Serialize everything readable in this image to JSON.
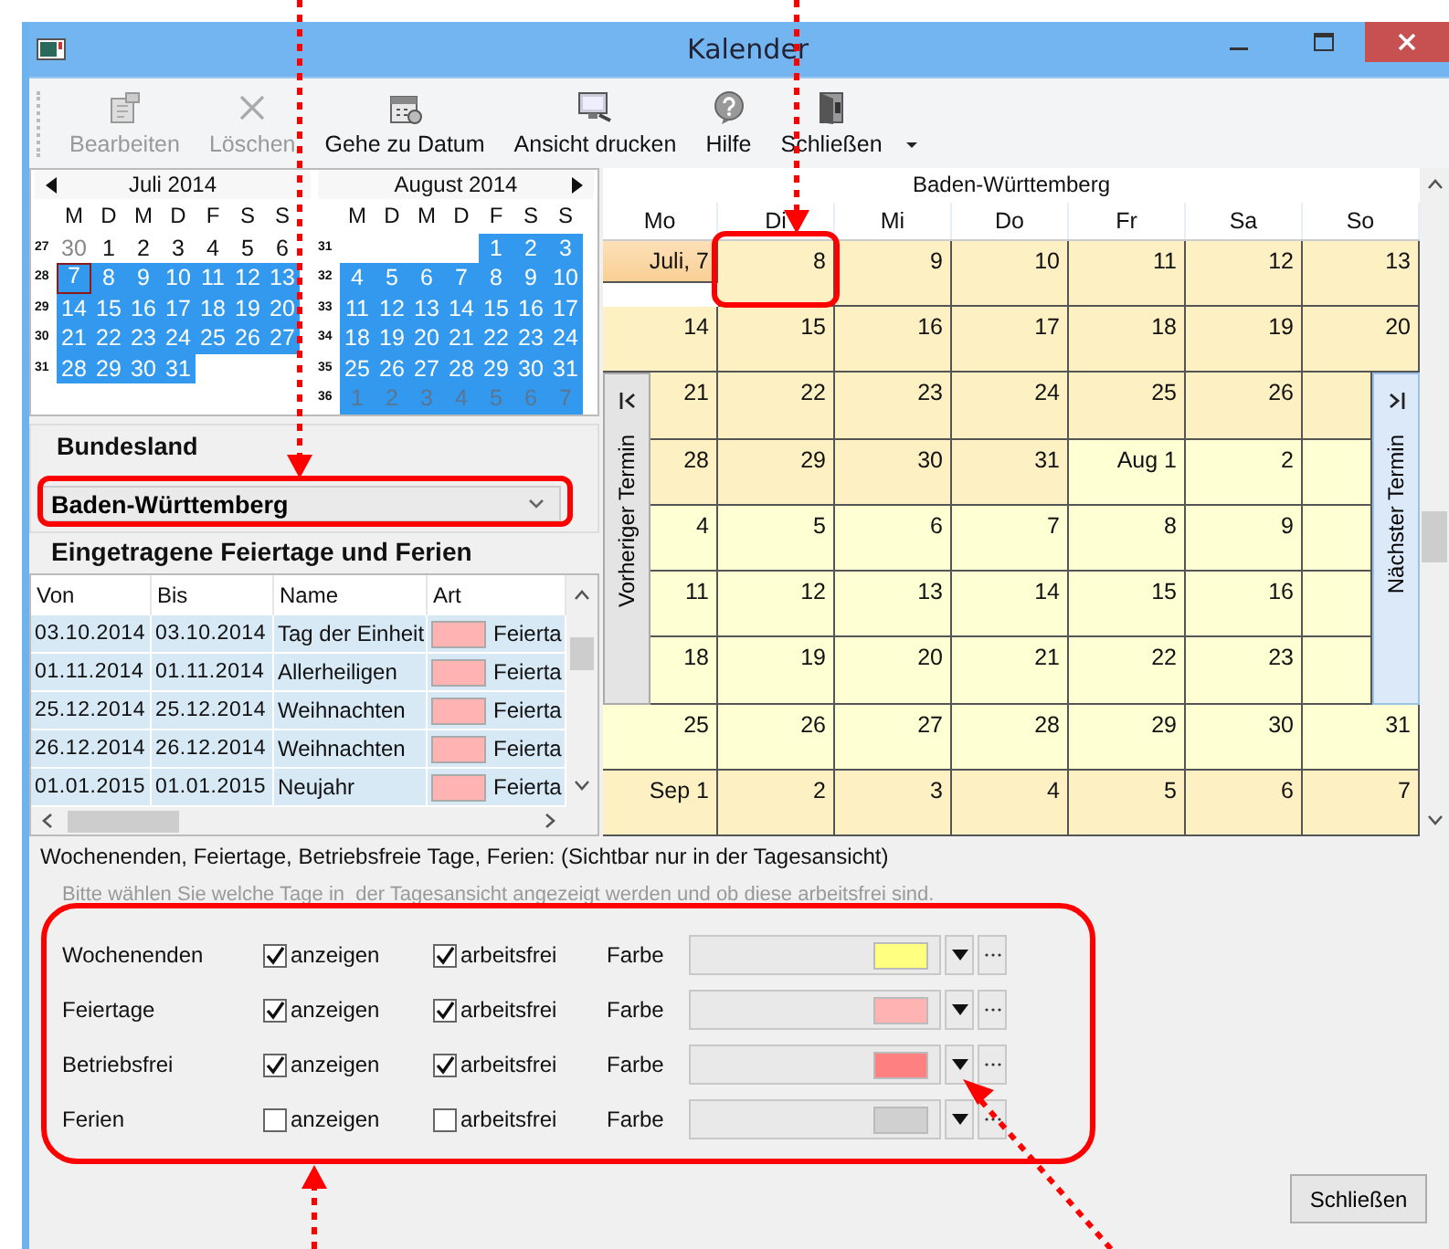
{
  "window": {
    "title": "Kalender"
  },
  "toolbar": [
    {
      "label": "Bearbeiten",
      "disabled": true
    },
    {
      "label": "Löschen",
      "disabled": true
    },
    {
      "label": "Gehe zu Datum",
      "disabled": false
    },
    {
      "label": "Ansicht drucken",
      "disabled": false
    },
    {
      "label": "Hilfe",
      "disabled": false
    },
    {
      "label": "Schließen",
      "disabled": false
    }
  ],
  "mini_calendars": [
    {
      "title": "Juli 2014",
      "weekdays": [
        "M",
        "D",
        "M",
        "D",
        "F",
        "S",
        "S"
      ],
      "weeks": [
        {
          "number": "27",
          "days": [
            {
              "label": "30",
              "selected": false,
              "muted": true,
              "today": false
            },
            {
              "label": "1",
              "selected": false,
              "muted": false,
              "today": false
            },
            {
              "label": "2",
              "selected": false,
              "muted": false,
              "today": false
            },
            {
              "label": "3",
              "selected": false,
              "muted": false,
              "today": false
            },
            {
              "label": "4",
              "selected": false,
              "muted": false,
              "today": false
            },
            {
              "label": "5",
              "selected": false,
              "muted": false,
              "today": false
            },
            {
              "label": "6",
              "selected": false,
              "muted": false,
              "today": false
            }
          ]
        },
        {
          "number": "28",
          "days": [
            {
              "label": "7",
              "selected": true,
              "muted": false,
              "today": true
            },
            {
              "label": "8",
              "selected": true,
              "muted": false,
              "today": false
            },
            {
              "label": "9",
              "selected": true,
              "muted": false,
              "today": false
            },
            {
              "label": "10",
              "selected": true,
              "muted": false,
              "today": false
            },
            {
              "label": "11",
              "selected": true,
              "muted": false,
              "today": false
            },
            {
              "label": "12",
              "selected": true,
              "muted": false,
              "today": false
            },
            {
              "label": "13",
              "selected": true,
              "muted": false,
              "today": false
            }
          ]
        },
        {
          "number": "29",
          "days": [
            {
              "label": "14",
              "selected": true,
              "muted": false,
              "today": false
            },
            {
              "label": "15",
              "selected": true,
              "muted": false,
              "today": false
            },
            {
              "label": "16",
              "selected": true,
              "muted": false,
              "today": false
            },
            {
              "label": "17",
              "selected": true,
              "muted": false,
              "today": false
            },
            {
              "label": "18",
              "selected": true,
              "muted": false,
              "today": false
            },
            {
              "label": "19",
              "selected": true,
              "muted": false,
              "today": false
            },
            {
              "label": "20",
              "selected": true,
              "muted": false,
              "today": false
            }
          ]
        },
        {
          "number": "30",
          "days": [
            {
              "label": "21",
              "selected": true,
              "muted": false,
              "today": false
            },
            {
              "label": "22",
              "selected": true,
              "muted": false,
              "today": false
            },
            {
              "label": "23",
              "selected": true,
              "muted": false,
              "today": false
            },
            {
              "label": "24",
              "selected": true,
              "muted": false,
              "today": false
            },
            {
              "label": "25",
              "selected": true,
              "muted": false,
              "today": false
            },
            {
              "label": "26",
              "selected": true,
              "muted": false,
              "today": false
            },
            {
              "label": "27",
              "selected": true,
              "muted": false,
              "today": false
            }
          ]
        },
        {
          "number": "31",
          "days": [
            {
              "label": "28",
              "selected": true,
              "muted": false,
              "today": false
            },
            {
              "label": "29",
              "selected": true,
              "muted": false,
              "today": false
            },
            {
              "label": "30",
              "selected": true,
              "muted": false,
              "today": false
            },
            {
              "label": "31",
              "selected": true,
              "muted": false,
              "today": false
            }
          ]
        }
      ]
    },
    {
      "title": "August 2014",
      "weekdays": [
        "M",
        "D",
        "M",
        "D",
        "F",
        "S",
        "S"
      ],
      "weeks": [
        {
          "number": "31",
          "days": [
            {
              "label": "1",
              "selected": true,
              "muted": false,
              "today": false
            },
            {
              "label": "2",
              "selected": true,
              "muted": false,
              "today": false
            },
            {
              "label": "3",
              "selected": true,
              "muted": false,
              "today": false
            }
          ]
        },
        {
          "number": "32",
          "days": [
            {
              "label": "4",
              "selected": true,
              "muted": false,
              "today": false
            },
            {
              "label": "5",
              "selected": true,
              "muted": false,
              "today": false
            },
            {
              "label": "6",
              "selected": true,
              "muted": false,
              "today": false
            },
            {
              "label": "7",
              "selected": true,
              "muted": false,
              "today": false
            },
            {
              "label": "8",
              "selected": true,
              "muted": false,
              "today": false
            },
            {
              "label": "9",
              "selected": true,
              "muted": false,
              "today": false
            },
            {
              "label": "10",
              "selected": true,
              "muted": false,
              "today": false
            }
          ]
        },
        {
          "number": "33",
          "days": [
            {
              "label": "11",
              "selected": true,
              "muted": false,
              "today": false
            },
            {
              "label": "12",
              "selected": true,
              "muted": false,
              "today": false
            },
            {
              "label": "13",
              "selected": true,
              "muted": false,
              "today": false
            },
            {
              "label": "14",
              "selected": true,
              "muted": false,
              "today": false
            },
            {
              "label": "15",
              "selected": true,
              "muted": false,
              "today": false
            },
            {
              "label": "16",
              "selected": true,
              "muted": false,
              "today": false
            },
            {
              "label": "17",
              "selected": true,
              "muted": false,
              "today": false
            }
          ]
        },
        {
          "number": "34",
          "days": [
            {
              "label": "18",
              "selected": true,
              "muted": false,
              "today": false
            },
            {
              "label": "19",
              "selected": true,
              "muted": false,
              "today": false
            },
            {
              "label": "20",
              "selected": true,
              "muted": false,
              "today": false
            },
            {
              "label": "21",
              "selected": true,
              "muted": false,
              "today": false
            },
            {
              "label": "22",
              "selected": true,
              "muted": false,
              "today": false
            },
            {
              "label": "23",
              "selected": true,
              "muted": false,
              "today": false
            },
            {
              "label": "24",
              "selected": true,
              "muted": false,
              "today": false
            }
          ]
        },
        {
          "number": "35",
          "days": [
            {
              "label": "25",
              "selected": true,
              "muted": false,
              "today": false
            },
            {
              "label": "26",
              "selected": true,
              "muted": false,
              "today": false
            },
            {
              "label": "27",
              "selected": true,
              "muted": false,
              "today": false
            },
            {
              "label": "28",
              "selected": true,
              "muted": false,
              "today": false
            },
            {
              "label": "29",
              "selected": true,
              "muted": false,
              "today": false
            },
            {
              "label": "30",
              "selected": true,
              "muted": false,
              "today": false
            },
            {
              "label": "31",
              "selected": true,
              "muted": false,
              "today": false
            }
          ]
        },
        {
          "number": "36",
          "days": [
            {
              "label": "1",
              "selected": true,
              "muted": true,
              "today": false
            },
            {
              "label": "2",
              "selected": true,
              "muted": true,
              "today": false
            },
            {
              "label": "3",
              "selected": true,
              "muted": true,
              "today": false
            },
            {
              "label": "4",
              "selected": true,
              "muted": true,
              "today": false
            },
            {
              "label": "5",
              "selected": true,
              "muted": true,
              "today": false
            },
            {
              "label": "6",
              "selected": true,
              "muted": true,
              "today": false
            },
            {
              "label": "7",
              "selected": true,
              "muted": true,
              "today": false
            }
          ]
        }
      ]
    }
  ],
  "state_group": {
    "label": "Bundesland",
    "value": "Baden-Württemberg"
  },
  "holidays": {
    "title": "Eingetragene Feiertage und Ferien",
    "columns": [
      "Von",
      "Bis",
      "Name",
      "Art"
    ],
    "rows": [
      {
        "from": "03.10.2014",
        "to": "03.10.2014",
        "name": "Tag der Einheit",
        "color": "#ffb3b3",
        "type": "Feierta"
      },
      {
        "from": "01.11.2014",
        "to": "01.11.2014",
        "name": "Allerheiligen",
        "color": "#ffb3b3",
        "type": "Feierta"
      },
      {
        "from": "25.12.2014",
        "to": "25.12.2014",
        "name": "Weihnachten",
        "color": "#ffb3b3",
        "type": "Feierta"
      },
      {
        "from": "26.12.2014",
        "to": "26.12.2014",
        "name": "Weihnachten",
        "color": "#ffb3b3",
        "type": "Feierta"
      },
      {
        "from": "01.01.2015",
        "to": "01.01.2015",
        "name": "Neujahr",
        "color": "#ffb3b3",
        "type": "Feierta"
      }
    ]
  },
  "month_view": {
    "title": "Baden-Württemberg",
    "weekdays": [
      "Mo",
      "Di",
      "Mi",
      "Do",
      "Fr",
      "Sa",
      "So"
    ],
    "side_buttons": [
      {
        "label": "Vorheriger Termin",
        "highlighted": false
      },
      {
        "label": "Nächster Termin",
        "highlighted": true
      }
    ],
    "weeks": [
      [
        {
          "label": "Juli, 7",
          "shaded": true,
          "today": true
        },
        {
          "label": "8",
          "shaded": true,
          "today": false
        },
        {
          "label": "9",
          "shaded": true,
          "today": false
        },
        {
          "label": "10",
          "shaded": true,
          "today": false
        },
        {
          "label": "11",
          "shaded": true,
          "today": false
        },
        {
          "label": "12",
          "shaded": true,
          "today": false
        },
        {
          "label": "13",
          "shaded": true,
          "today": false
        }
      ],
      [
        {
          "label": "14",
          "shaded": true,
          "today": false
        },
        {
          "label": "15",
          "shaded": true,
          "today": false
        },
        {
          "label": "16",
          "shaded": true,
          "today": false
        },
        {
          "label": "17",
          "shaded": true,
          "today": false
        },
        {
          "label": "18",
          "shaded": true,
          "today": false
        },
        {
          "label": "19",
          "shaded": true,
          "today": false
        },
        {
          "label": "20",
          "shaded": true,
          "today": false
        }
      ],
      [
        {
          "label": "21",
          "shaded": true,
          "today": false
        },
        {
          "label": "22",
          "shaded": true,
          "today": false
        },
        {
          "label": "23",
          "shaded": true,
          "today": false
        },
        {
          "label": "24",
          "shaded": true,
          "today": false
        },
        {
          "label": "25",
          "shaded": true,
          "today": false
        },
        {
          "label": "26",
          "shaded": true,
          "today": false
        },
        {
          "shaded": true,
          "today": false
        }
      ],
      [
        {
          "label": "28",
          "shaded": true,
          "today": false
        },
        {
          "label": "29",
          "shaded": true,
          "today": false
        },
        {
          "label": "30",
          "shaded": true,
          "today": false
        },
        {
          "label": "31",
          "shaded": true,
          "today": false
        },
        {
          "label": "Aug 1",
          "shaded": false,
          "today": false
        },
        {
          "label": "2",
          "shaded": false,
          "today": false
        },
        {
          "shaded": false,
          "today": false
        }
      ],
      [
        {
          "label": "4",
          "shaded": false,
          "today": false
        },
        {
          "label": "5",
          "shaded": false,
          "today": false
        },
        {
          "label": "6",
          "shaded": false,
          "today": false
        },
        {
          "label": "7",
          "shaded": false,
          "today": false
        },
        {
          "label": "8",
          "shaded": false,
          "today": false
        },
        {
          "label": "9",
          "shaded": false,
          "today": false
        },
        {
          "shaded": false,
          "today": false
        }
      ],
      [
        {
          "label": "11",
          "shaded": false,
          "today": false
        },
        {
          "label": "12",
          "shaded": false,
          "today": false
        },
        {
          "label": "13",
          "shaded": false,
          "today": false
        },
        {
          "label": "14",
          "shaded": false,
          "today": false
        },
        {
          "label": "15",
          "shaded": false,
          "today": false
        },
        {
          "label": "16",
          "shaded": false,
          "today": false
        },
        {
          "shaded": false,
          "today": false
        }
      ],
      [
        {
          "label": "18",
          "shaded": false,
          "today": false
        },
        {
          "label": "19",
          "shaded": false,
          "today": false
        },
        {
          "label": "20",
          "shaded": false,
          "today": false
        },
        {
          "label": "21",
          "shaded": false,
          "today": false
        },
        {
          "label": "22",
          "shaded": false,
          "today": false
        },
        {
          "label": "23",
          "shaded": false,
          "today": false
        },
        {
          "shaded": false,
          "today": false
        }
      ],
      [
        {
          "label": "25",
          "shaded": false,
          "today": false
        },
        {
          "label": "26",
          "shaded": false,
          "today": false
        },
        {
          "label": "27",
          "shaded": false,
          "today": false
        },
        {
          "label": "28",
          "shaded": false,
          "today": false
        },
        {
          "label": "29",
          "shaded": false,
          "today": false
        },
        {
          "label": "30",
          "shaded": false,
          "today": false
        },
        {
          "label": "31",
          "shaded": false,
          "today": false
        }
      ],
      [
        {
          "label": "Sep 1",
          "shaded": true,
          "today": false
        },
        {
          "label": "2",
          "shaded": true,
          "today": false
        },
        {
          "label": "3",
          "shaded": true,
          "today": false
        },
        {
          "label": "4",
          "shaded": true,
          "today": false
        },
        {
          "label": "5",
          "shaded": true,
          "today": false
        },
        {
          "label": "6",
          "shaded": true,
          "today": false
        },
        {
          "label": "7",
          "shaded": true,
          "today": false
        }
      ]
    ]
  },
  "day_settings": {
    "title": "Wochenenden, Feiertage, Betriebsfreie Tage, Ferien: (Sichtbar nur in der Tagesansicht)",
    "hint": "Bitte wählen Sie welche Tage in  der Tagesansicht angezeigt werden und ob diese arbeitsfrei sind.",
    "rows": [
      {
        "name": "Wochenenden",
        "show": {
          "label": "anzeigen",
          "checked": true
        },
        "free": {
          "label": "arbeitsfrei",
          "checked": true
        },
        "color_label": "Farbe",
        "color": "#ffff80"
      },
      {
        "name": "Feiertage",
        "show": {
          "label": "anzeigen",
          "checked": true
        },
        "free": {
          "label": "arbeitsfrei",
          "checked": true
        },
        "color_label": "Farbe",
        "color": "#ffb3b3"
      },
      {
        "name": "Betriebsfrei",
        "show": {
          "label": "anzeigen",
          "checked": true
        },
        "free": {
          "label": "arbeitsfrei",
          "checked": true
        },
        "color_label": "Farbe",
        "color": "#ff8080"
      },
      {
        "name": "Ferien",
        "show": {
          "label": "anzeigen",
          "checked": false
        },
        "free": {
          "label": "arbeitsfrei",
          "checked": false
        },
        "color_label": "Farbe",
        "color": "#d0d0d0"
      }
    ]
  },
  "close_button": {
    "label": "Schließen"
  }
}
